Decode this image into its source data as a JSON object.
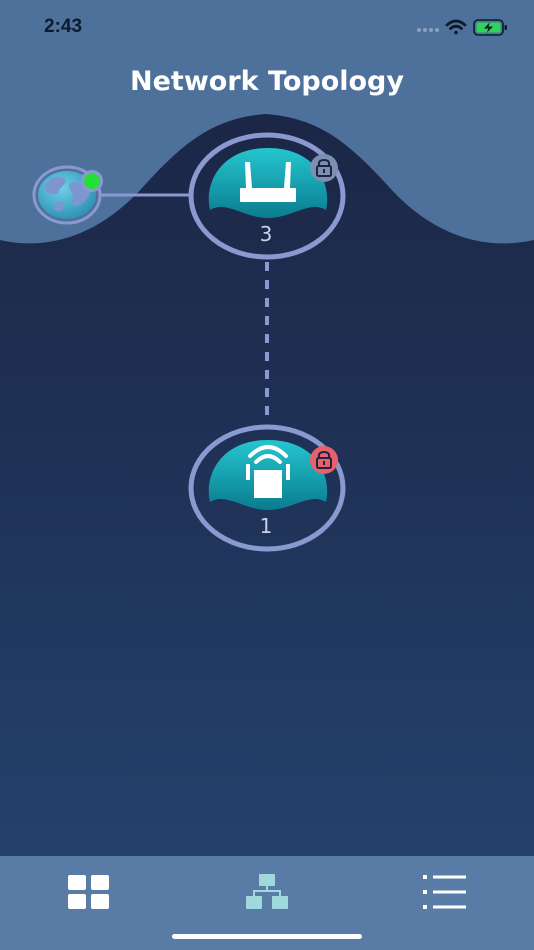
{
  "status_bar": {
    "time": "2:43",
    "signal_icon": "cellular-signal-icon",
    "wifi_icon": "wifi-icon",
    "battery_icon": "battery-charging-icon",
    "battery_color": "#2fd35b"
  },
  "header": {
    "title": "Network Topology"
  },
  "topology": {
    "internet": {
      "icon": "globe-icon",
      "status_color": "#22e035"
    },
    "router": {
      "icon": "router-icon",
      "count": "3",
      "lock_icon": "lock-icon",
      "lock_color": "#7d8fb0"
    },
    "extender": {
      "icon": "range-extender-icon",
      "count": "1",
      "lock_icon": "lock-icon",
      "lock_color": "#e8606a"
    },
    "colors": {
      "node_ring": "#8b99d1",
      "node_fill_top": "#25c6cf",
      "node_fill_bottom": "#0a7c8f",
      "wave": "#4e719c"
    }
  },
  "tab_bar": {
    "tabs": [
      {
        "name": "dashboard",
        "icon": "grid-icon",
        "active": false
      },
      {
        "name": "topology",
        "icon": "topology-icon",
        "active": true
      },
      {
        "name": "list",
        "icon": "list-icon",
        "active": false
      }
    ],
    "active_color": "#9fd9dc"
  }
}
